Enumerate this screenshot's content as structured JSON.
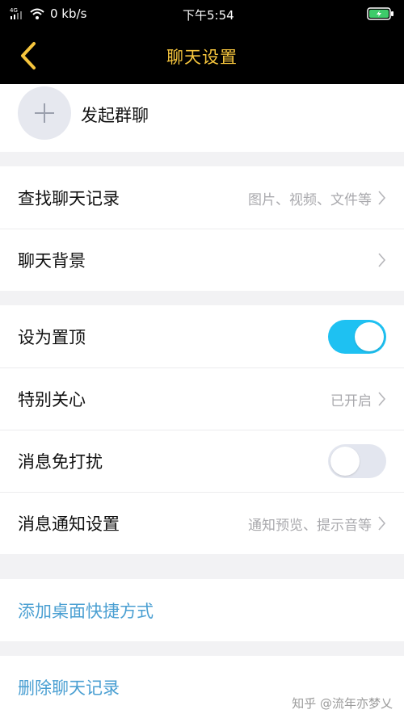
{
  "status_bar": {
    "signal_label": "4G",
    "speed": "0 kb/s",
    "time": "下午5:54"
  },
  "nav": {
    "title": "聊天设置"
  },
  "group": {
    "start_group_label": "发起群聊"
  },
  "section1": {
    "find_history_label": "查找聊天记录",
    "find_history_detail": "图片、视频、文件等",
    "background_label": "聊天背景"
  },
  "section2": {
    "pin_label": "设为置顶",
    "pin_on": true,
    "special_care_label": "特别关心",
    "special_care_detail": "已开启",
    "dnd_label": "消息免打扰",
    "dnd_on": false,
    "notify_label": "消息通知设置",
    "notify_detail": "通知预览、提示音等"
  },
  "actions": {
    "shortcut_label": "添加桌面快捷方式",
    "delete_history_label": "删除聊天记录"
  },
  "watermark": "知乎 @流年亦梦乂",
  "colors": {
    "title_accent": "#f6c53d",
    "toggle_on": "#1ec1f2",
    "link": "#4a9fd2"
  }
}
